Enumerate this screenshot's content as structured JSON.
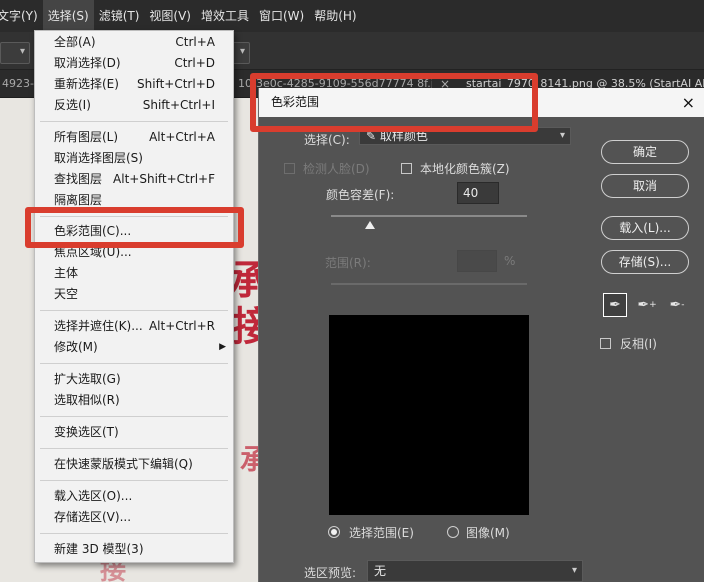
{
  "menubar": {
    "items": [
      {
        "label": "文字(Y)"
      },
      {
        "label": "选择(S)"
      },
      {
        "label": "滤镜(T)"
      },
      {
        "label": "视图(V)"
      },
      {
        "label": "增效工具"
      },
      {
        "label": "窗口(W)"
      },
      {
        "label": "帮助(H)"
      }
    ]
  },
  "tabs": {
    "left_tab": "4923-",
    "middle_tab": "10-3e0c-4285-9109-556d77774 8f.jpg",
    "middle_close": "×",
    "right_tab": "startai_7970_8141.png @ 38.5% (StartAI AI生"
  },
  "select_menu": {
    "groups": [
      [
        {
          "label": "全部(A)",
          "shortcut": "Ctrl+A",
          "disabled": false
        },
        {
          "label": "取消选择(D)",
          "shortcut": "Ctrl+D",
          "disabled": false
        },
        {
          "label": "重新选择(E)",
          "shortcut": "Shift+Ctrl+D",
          "disabled": false
        },
        {
          "label": "反选(I)",
          "shortcut": "Shift+Ctrl+I",
          "disabled": false
        }
      ],
      [
        {
          "label": "所有图层(L)",
          "shortcut": "Alt+Ctrl+A",
          "disabled": false
        },
        {
          "label": "取消选择图层(S)",
          "shortcut": "",
          "disabled": false
        },
        {
          "label": "查找图层",
          "shortcut": "Alt+Shift+Ctrl+F",
          "disabled": false
        },
        {
          "label": "隔离图层",
          "shortcut": "",
          "disabled": false
        }
      ],
      [
        {
          "label": "色彩范围(C)...",
          "shortcut": "",
          "disabled": false
        },
        {
          "label": "焦点区域(U)...",
          "shortcut": "",
          "disabled": false
        },
        {
          "label": "主体",
          "shortcut": "",
          "disabled": false
        },
        {
          "label": "天空",
          "shortcut": "",
          "disabled": false
        }
      ],
      [
        {
          "label": "选择并遮住(K)...",
          "shortcut": "Alt+Ctrl+R",
          "disabled": false
        },
        {
          "label": "修改(M)",
          "shortcut": "",
          "submenu": true,
          "disabled": false
        }
      ],
      [
        {
          "label": "扩大选取(G)",
          "shortcut": "",
          "disabled": false
        },
        {
          "label": "选取相似(R)",
          "shortcut": "",
          "disabled": false
        }
      ],
      [
        {
          "label": "变换选区(T)",
          "shortcut": "",
          "disabled": false
        }
      ],
      [
        {
          "label": "在快速蒙版模式下编辑(Q)",
          "shortcut": "",
          "disabled": false
        }
      ],
      [
        {
          "label": "载入选区(O)...",
          "shortcut": "",
          "disabled": false
        },
        {
          "label": "存储选区(V)...",
          "shortcut": "",
          "disabled": false
        }
      ],
      [
        {
          "label": "新建 3D 模型(3)",
          "shortcut": "",
          "disabled": false
        }
      ]
    ]
  },
  "dialog": {
    "title": "色彩范围",
    "close_glyph": "×",
    "select_label": "选择(C):",
    "select_value": "取样颜色",
    "detect_faces": "检测人脸(D)",
    "localized_clusters": "本地化颜色簇(Z)",
    "fuzziness_label": "颜色容差(F):",
    "fuzziness_value": "40",
    "range_label": "范围(R):",
    "range_unit": "%",
    "buttons": {
      "ok": "确定",
      "cancel": "取消",
      "load": "载入(L)...",
      "save": "存储(S)..."
    },
    "invert": "反相(I)",
    "radio_selection": "选择范围(E)",
    "radio_image": "图像(M)",
    "preview_label": "选区预览:",
    "preview_value": "无"
  },
  "colors": {
    "highlight": "#d93d2e",
    "canvas_mark": "#c0283a"
  },
  "canvas": {
    "glyph_a": "承",
    "glyph_b": "接"
  }
}
